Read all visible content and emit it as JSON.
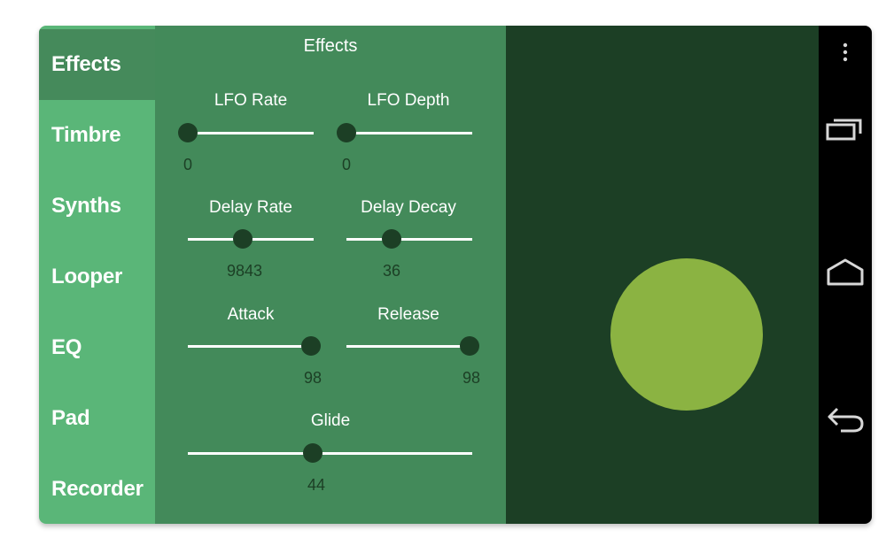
{
  "sidebar": {
    "items": [
      {
        "label": "Effects",
        "active": true
      },
      {
        "label": "Timbre",
        "active": false
      },
      {
        "label": "Synths",
        "active": false
      },
      {
        "label": "Looper",
        "active": false
      },
      {
        "label": "EQ",
        "active": false
      },
      {
        "label": "Pad",
        "active": false
      },
      {
        "label": "Recorder",
        "active": false
      }
    ]
  },
  "panel": {
    "title": "Effects",
    "controls": {
      "lfo_rate": {
        "label": "LFO Rate",
        "value": "0",
        "fraction": 0.0
      },
      "lfo_depth": {
        "label": "LFO Depth",
        "value": "0",
        "fraction": 0.0
      },
      "delay_rate": {
        "label": "Delay Rate",
        "value": "9843",
        "fraction": 0.44
      },
      "delay_decay": {
        "label": "Delay Decay",
        "value": "36",
        "fraction": 0.36
      },
      "attack": {
        "label": "Attack",
        "value": "98",
        "fraction": 0.98
      },
      "release": {
        "label": "Release",
        "value": "98",
        "fraction": 0.98
      },
      "glide": {
        "label": "Glide",
        "value": "44",
        "fraction": 0.44
      }
    }
  },
  "colors": {
    "sidebar_bg": "#5ab678",
    "sidebar_active": "#458a5b",
    "panel_bg": "#438a5a",
    "pad_bg": "#1c3f25",
    "pad_circle": "#8bb342",
    "slider_thumb": "#1c3f25",
    "navbar_bg": "#000000"
  },
  "navbar": {
    "icons": [
      "overflow-menu-icon",
      "recent-apps-icon",
      "home-icon",
      "back-icon"
    ]
  }
}
